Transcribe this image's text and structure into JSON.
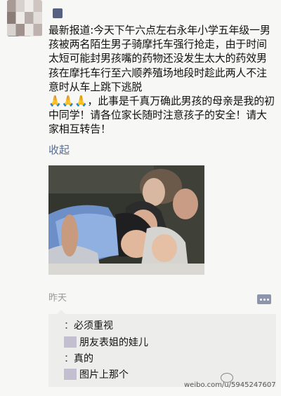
{
  "post": {
    "paragraph1": "最新报道:今天下午六点左右永年小学五年级一男孩被两名陌生男子骑摩托车强行抢走，由于时间太短可能封男孩嘴的药物还没发生太大的药效男孩在摩托车行至六顺养殖场地段时趁此两人不注意时从车上跳下逃脱",
    "paragraph2": "🙏🙏🙏，此事是千真万确此男孩的母亲是我的初中同学！请各位家长随时注意孩子的安全！请大家相互转告！",
    "collapse_label": "收起",
    "time": "昨天"
  },
  "comments": [
    {
      "prefix": "：",
      "text": "必须重视"
    },
    {
      "prefix": "",
      "text": "朋友表姐的娃儿"
    },
    {
      "prefix": "：",
      "text": "真的"
    },
    {
      "prefix": "",
      "text": "图片上那个"
    }
  ],
  "watermark": {
    "text": "weibo.com/u/5945247607"
  },
  "colors": {
    "link": "#586c94",
    "background": "#f7f7f5",
    "comment_bg": "#ededeb"
  }
}
